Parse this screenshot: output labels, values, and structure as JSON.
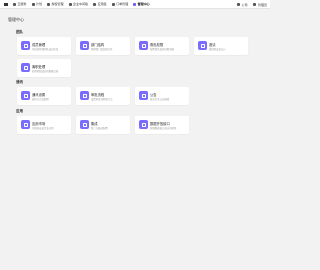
{
  "topbar": {
    "items": [
      {
        "label": "云服务",
        "icon": "cloud-icon"
      },
      {
        "label": "计划",
        "icon": "calendar-icon"
      },
      {
        "label": "授权管理",
        "icon": "key-icon"
      },
      {
        "label": "企业中间版",
        "icon": "building-icon"
      },
      {
        "label": "应用集",
        "icon": "apps-icon"
      },
      {
        "label": "订单管理",
        "icon": "order-icon"
      },
      {
        "label": "管理中心",
        "icon": "admin-icon"
      }
    ],
    "right": [
      {
        "label": "公司",
        "icon": "company-icon"
      },
      {
        "label": "管理员",
        "icon": "user-icon"
      }
    ]
  },
  "page_title": "管理中心",
  "sections": [
    {
      "title": "团队",
      "cards": [
        {
          "name": "成员管理",
          "desc": "添加和管理团队成员信息",
          "icon": "members-icon"
        },
        {
          "name": "部门结构",
          "desc": "管理部门及层级关系",
          "icon": "org-icon"
        },
        {
          "name": "角色权限",
          "desc": "配置角色及其权限范围",
          "icon": "role-icon"
        },
        {
          "name": "邀请",
          "desc": "邀请新成员加入",
          "icon": "invite-icon"
        },
        {
          "name": "离职处理",
          "desc": "处理离职成员的数据交接",
          "icon": "leave-icon"
        }
      ]
    },
    {
      "title": "通讯",
      "cards": [
        {
          "name": "通讯设置",
          "desc": "通讯方式及配置",
          "icon": "message-icon"
        },
        {
          "name": "审批流程",
          "desc": "设置审批流程和节点",
          "icon": "approval-icon"
        },
        {
          "name": "公告",
          "desc": "发布企业公告通知",
          "icon": "notice-icon"
        }
      ]
    },
    {
      "title": "应用",
      "cards": [
        {
          "name": "应用市场",
          "desc": "浏览和安装企业应用",
          "icon": "store-icon"
        },
        {
          "name": "集成",
          "desc": "第三方集成配置",
          "icon": "integration-icon"
        },
        {
          "name": "数据开放接口",
          "desc": "管理数据接口和访问密钥",
          "icon": "api-icon"
        }
      ]
    }
  ],
  "colors": {
    "accent": "#7a6cff",
    "background": "#f2f2f2",
    "card": "#ffffff"
  }
}
